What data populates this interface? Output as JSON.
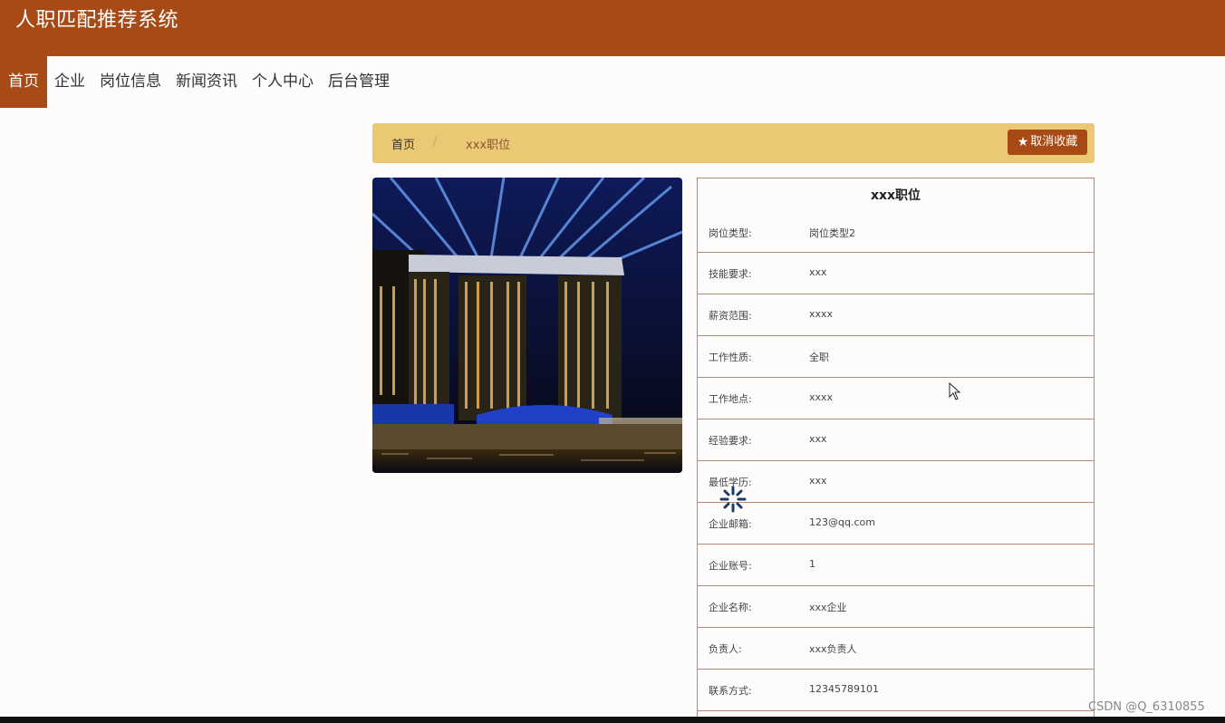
{
  "site": {
    "title": "人职匹配推荐系统"
  },
  "nav": [
    {
      "label": "首页",
      "active": true
    },
    {
      "label": "企业"
    },
    {
      "label": "岗位信息"
    },
    {
      "label": "新闻资讯"
    },
    {
      "label": "个人中心"
    },
    {
      "label": "后台管理"
    }
  ],
  "breadcrumb": {
    "home": "首页",
    "separator": "/",
    "current": "xxx职位"
  },
  "actions": {
    "unfavorite": "取消收藏"
  },
  "job": {
    "title": "xxx职位",
    "fields": [
      {
        "label": "岗位类型:",
        "value": "岗位类型2"
      },
      {
        "label": "技能要求:",
        "value": "xxx"
      },
      {
        "label": "薪资范围:",
        "value": "xxxx"
      },
      {
        "label": "工作性质:",
        "value": "全职"
      },
      {
        "label": "工作地点:",
        "value": "xxxx"
      },
      {
        "label": "经验要求:",
        "value": "xxx"
      },
      {
        "label": "最低学历:",
        "value": "xxx"
      },
      {
        "label": "企业邮箱:",
        "value": "123@qq.com"
      },
      {
        "label": "企业账号:",
        "value": "1"
      },
      {
        "label": "企业名称:",
        "value": "xxx企业"
      },
      {
        "label": "负责人:",
        "value": "xxx负责人"
      },
      {
        "label": "联系方式:",
        "value": "12345789101"
      }
    ]
  },
  "watermark": "CSDN @Q_6310855",
  "colors": {
    "primary": "#a84a16",
    "breadcrumb_bg": "#eac874",
    "border": "#b58a72"
  }
}
